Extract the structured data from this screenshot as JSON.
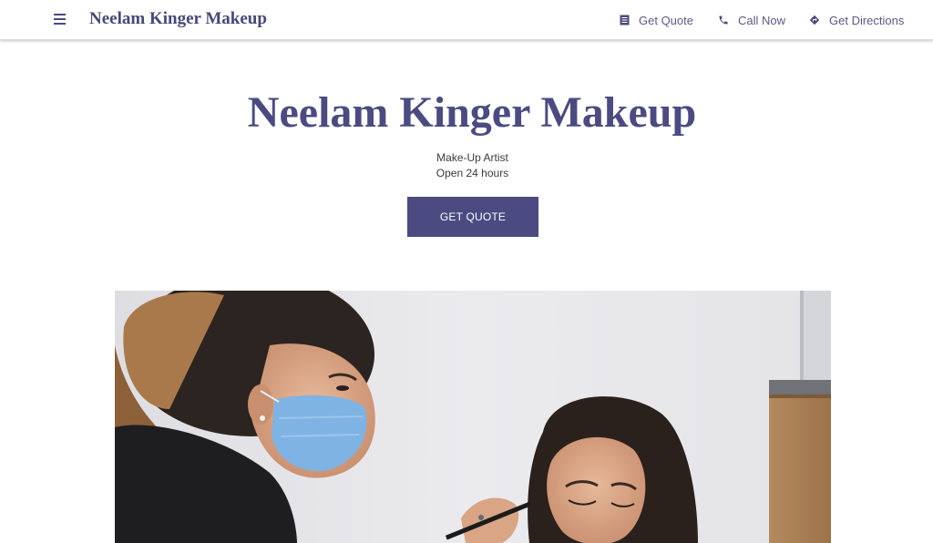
{
  "header": {
    "brand": "Neelam Kinger Makeup",
    "menu_icon": "hamburger-menu-icon",
    "actions": [
      {
        "label": "Get Quote",
        "icon": "quote-form-icon"
      },
      {
        "label": "Call Now",
        "icon": "phone-icon"
      },
      {
        "label": "Get Directions",
        "icon": "directions-icon"
      }
    ]
  },
  "hero": {
    "title": "Neelam Kinger Makeup",
    "category": "Make-Up Artist",
    "hours": "Open 24 hours",
    "cta_label": "GET QUOTE"
  },
  "colors": {
    "brand": "#4b4b82",
    "text": "#3a3a3a",
    "background": "#ffffff"
  }
}
